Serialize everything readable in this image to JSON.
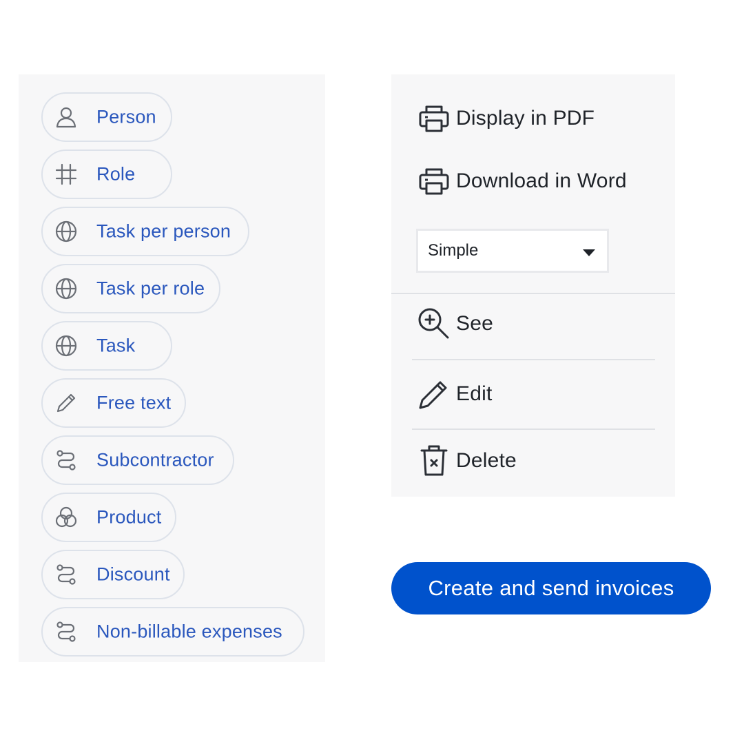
{
  "colors": {
    "accent": "#0052cc",
    "pill_text": "#2a57bd",
    "pill_border": "#dde2ea",
    "panel_bg": "#f7f7f8",
    "icon_gray": "#6b6f76"
  },
  "line_types": [
    {
      "label": "Person",
      "icon": "person-icon"
    },
    {
      "label": "Role",
      "icon": "hash-icon"
    },
    {
      "label": "Task per person",
      "icon": "globe-icon"
    },
    {
      "label": "Task per role",
      "icon": "globe-icon"
    },
    {
      "label": "Task",
      "icon": "globe-icon"
    },
    {
      "label": "Free text",
      "icon": "pencil-icon"
    },
    {
      "label": "Subcontractor",
      "icon": "route-icon"
    },
    {
      "label": "Product",
      "icon": "product-icon"
    },
    {
      "label": "Discount",
      "icon": "route-icon"
    },
    {
      "label": "Non-billable expenses",
      "icon": "route-icon"
    }
  ],
  "actions": {
    "display_pdf": {
      "label": "Display in PDF",
      "icon": "printer-icon"
    },
    "download_word": {
      "label": "Download in Word",
      "icon": "printer-icon"
    },
    "template_select": {
      "value": "Simple"
    },
    "see": {
      "label": "See",
      "icon": "zoom-in-icon"
    },
    "edit": {
      "label": "Edit",
      "icon": "pencil-icon"
    },
    "delete": {
      "label": "Delete",
      "icon": "trash-icon"
    }
  },
  "cta": {
    "label": "Create and send invoices"
  }
}
